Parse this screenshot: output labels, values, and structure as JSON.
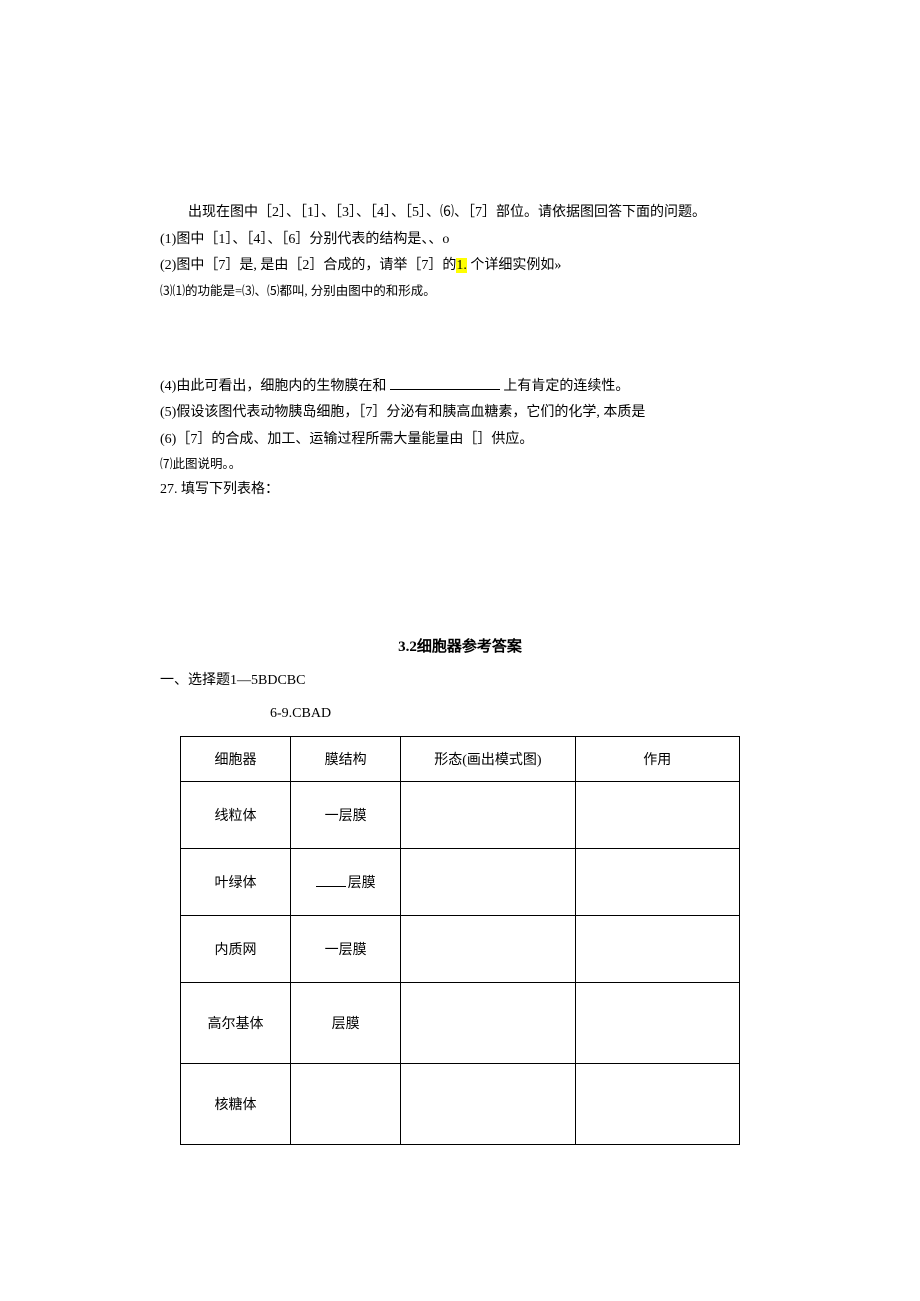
{
  "p": {
    "l1": "出现在图中［2］、［1］、［3］、［4］、［5］、⑹、［7］部位。请依据图回答下面的问题。",
    "l2": "(1)图中［1］、［4］、［6］分别代表的结构是、、o",
    "l3a": "(2)图中［7］是, 是由［2］合成的，请举［7］的",
    "l3b": "1.",
    "l3c": " 个详细实例如»",
    "l4": "⑶⑴的功能是=⑶、⑸都叫, 分别由图中的和形成。",
    "l5a": "(4)由此可看出，细胞内的生物膜在和 ",
    "l5b": " 上有肯定的连续性。",
    "l6": "(5)假设该图代表动物胰岛细胞，［7］分泌有和胰高血糖素，它们的化学, 本质是",
    "l7": "(6)［7］的合成、加工、运输过程所需大量能量由［］供应。",
    "l8": "⑺此图说明｡。",
    "l9": "27. 填写下列表格：",
    "title": "3.2细胞器参考答案",
    "sect": "一、选择题1—5BDCBC",
    "sub": "6-9.CBAD"
  },
  "table": {
    "h1": "细胞器",
    "h2": "膜结构",
    "h3": "形态(画出模式图)",
    "h4": "作用",
    "r1c1": "线粒体",
    "r1c2": "一层膜",
    "r2c1": "叶绿体",
    "r2c2b": "层膜",
    "r3c1": "内质网",
    "r3c2": "一层膜",
    "r4c1": "高尔基体",
    "r4c2": "层膜",
    "r5c1": "核糖体"
  }
}
